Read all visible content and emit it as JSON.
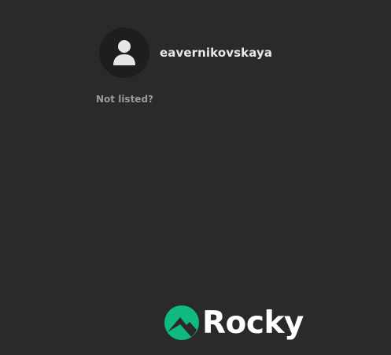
{
  "login": {
    "users": [
      {
        "name": "eavernikovskaya",
        "avatar_icon": "user-silhouette-icon"
      }
    ],
    "not_listed_label": "Not listed?"
  },
  "branding": {
    "logo_text": "Rocky",
    "logo_icon": "rocky-mountain-icon",
    "accent_color": "#10b981"
  },
  "colors": {
    "background": "#2a2a2a",
    "avatar_bg": "#1e1e1e",
    "text": "#e8e8e8",
    "muted_text": "#9a9a9a"
  }
}
